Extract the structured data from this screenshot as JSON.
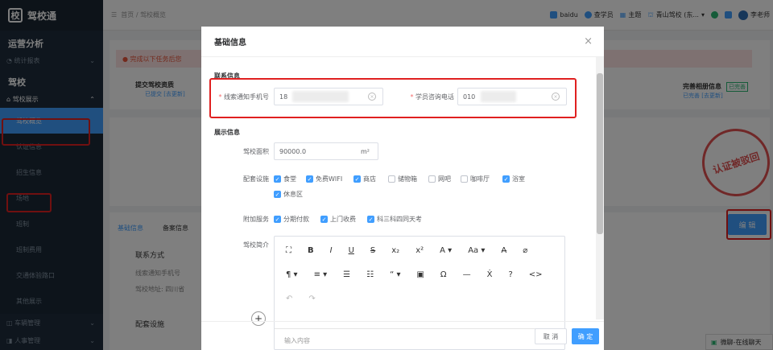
{
  "sidebar": {
    "logo_icon": "校",
    "logo_text": "驾校通",
    "section1": "运营分析",
    "item_stats": "统计报表",
    "section2": "驾校",
    "item_display": "驾校展示",
    "sub_items": [
      "驾校概览",
      "认证信息",
      "招生信息",
      "场地",
      "班制",
      "班制费用",
      "交通体验路口",
      "其他展示"
    ],
    "item_vehicle": "车辆管理",
    "item_hr": "人事管理"
  },
  "topbar": {
    "home": "首页",
    "separator": "/",
    "current": "驾校概览",
    "links": [
      "baidu",
      "查学员",
      "主题",
      "青山驾校 (东...",
      "李老师"
    ]
  },
  "page": {
    "warn_text": "完成以下任务后您",
    "step1_title": "提交驾校资质",
    "step1_sub": "已提交 [去更新]",
    "step_done_title": "完善相册信息",
    "step_done_badge": "已完善",
    "step_done_sub": "已完善 [去更新]",
    "tabs": [
      "基础信息",
      "备案信息"
    ],
    "contact_title": "联系方式",
    "contact_line1": "线索通知手机号",
    "contact_line2": "驾校地址: 四川省",
    "facilities_title": "配套设施",
    "stamp_text": "认证被驳回",
    "edit_button": "编 辑",
    "chat_text": "微聊-在线聊天"
  },
  "dialog": {
    "title": "基础信息",
    "close": "×",
    "contact_section": "联系信息",
    "phone_label": "线索通知手机号",
    "phone_value": "18",
    "hotline_label": "学员咨询电话",
    "hotline_value": "010",
    "display_section": "展示信息",
    "area_label": "驾校面积",
    "area_value": "90000.0",
    "area_unit": "m²",
    "facility_label": "配套设施",
    "facilities": [
      {
        "label": "食堂",
        "checked": true
      },
      {
        "label": "免费WIFI",
        "checked": true
      },
      {
        "label": "商店",
        "checked": true
      },
      {
        "label": "储物箱",
        "checked": false
      },
      {
        "label": "网吧",
        "checked": false
      },
      {
        "label": "咖啡厅",
        "checked": false
      },
      {
        "label": "浴室",
        "checked": true
      },
      {
        "label": "休息区",
        "checked": true
      }
    ],
    "service_label": "附加服务",
    "services": [
      {
        "label": "分期付款",
        "checked": true
      },
      {
        "label": "上门收费",
        "checked": true
      },
      {
        "label": "科三科四同天考",
        "checked": true
      }
    ],
    "intro_label": "驾校简介",
    "toolbar_row1": [
      "⛶",
      "B",
      "I",
      "U",
      "S",
      "x₂",
      "x²",
      "A ▾",
      "Aa ▾",
      "A̶",
      "⌀"
    ],
    "toolbar_row2": [
      "¶ ▾",
      "≡ ▾",
      "☰",
      "☷",
      "“ ▾",
      "▣",
      "Ω",
      "—",
      "Ẋ",
      "?",
      "<>"
    ],
    "toolbar_row3": [
      "↶",
      "↷"
    ],
    "editor_placeholder": "输入内容",
    "cancel_button": "取 消",
    "ok_button": "确 定"
  },
  "colors": {
    "primary": "#409eff",
    "highlight_border": "#e02020",
    "sidebar_bg": "#1f2d3d"
  }
}
